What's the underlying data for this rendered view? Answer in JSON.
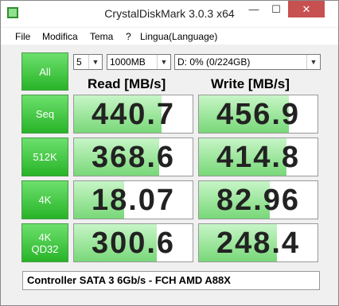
{
  "window": {
    "title": "CrystalDiskMark 3.0.3 x64"
  },
  "menu": [
    "File",
    "Modifica",
    "Tema",
    "?",
    "Lingua(Language)"
  ],
  "controls": {
    "all_label": "All",
    "runs": "5",
    "size": "1000MB",
    "drive": "D: 0% (0/224GB)"
  },
  "headers": {
    "read": "Read [MB/s]",
    "write": "Write [MB/s]"
  },
  "tests": [
    {
      "label": "Seq",
      "read": "440.7",
      "write": "456.9",
      "read_fill": 0.74,
      "write_fill": 0.76
    },
    {
      "label": "512K",
      "read": "368.6",
      "write": "414.8",
      "read_fill": 0.72,
      "write_fill": 0.74
    },
    {
      "label": "4K",
      "read": "18.07",
      "write": "82.96",
      "read_fill": 0.42,
      "write_fill": 0.6
    },
    {
      "label": "4K\nQD32",
      "read": "300.6",
      "write": "248.4",
      "read_fill": 0.7,
      "write_fill": 0.66
    }
  ],
  "status": "Controller SATA 3 6Gb/s - FCH AMD A88X",
  "colors": {
    "button_green": "#28b428",
    "bar_green": "#78d878",
    "close_red": "#c75050"
  }
}
